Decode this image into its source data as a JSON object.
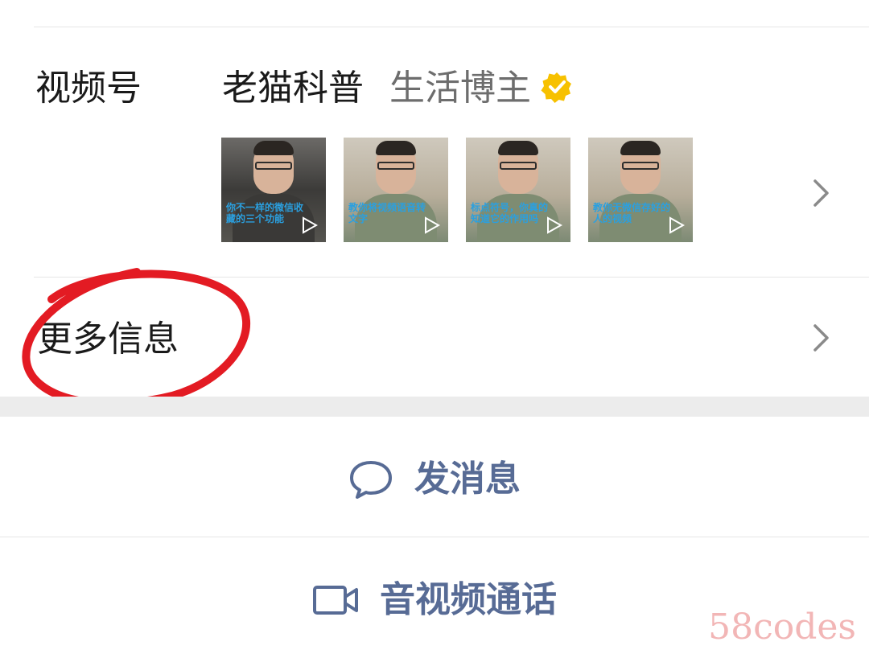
{
  "video_channel": {
    "label": "视频号",
    "name": "老猫科普",
    "tag": "生活博主",
    "thumbnails": [
      {
        "caption": "你不一样的微信收藏的三个功能",
        "style": "dark"
      },
      {
        "caption": "教你将视频语音转文字",
        "style": "light"
      },
      {
        "caption": "标点符号，你真的知道它的作用吗",
        "style": "light"
      },
      {
        "caption": "教你无微信存好的人的视频",
        "style": "light"
      }
    ]
  },
  "more_info": {
    "label": "更多信息"
  },
  "actions": {
    "message_label": "发消息",
    "call_label": "音视频通话"
  },
  "watermark": "58codes",
  "colors": {
    "link_blue": "#576b95",
    "verified_gold": "#f7c100",
    "annotation_red": "#e31b23",
    "caption_blue": "#2aa0e0"
  },
  "icons": {
    "verified": "verified-badge-icon",
    "play": "play-icon",
    "chevron": "chevron-right-icon",
    "message": "chat-bubble-icon",
    "call": "video-camera-icon"
  }
}
